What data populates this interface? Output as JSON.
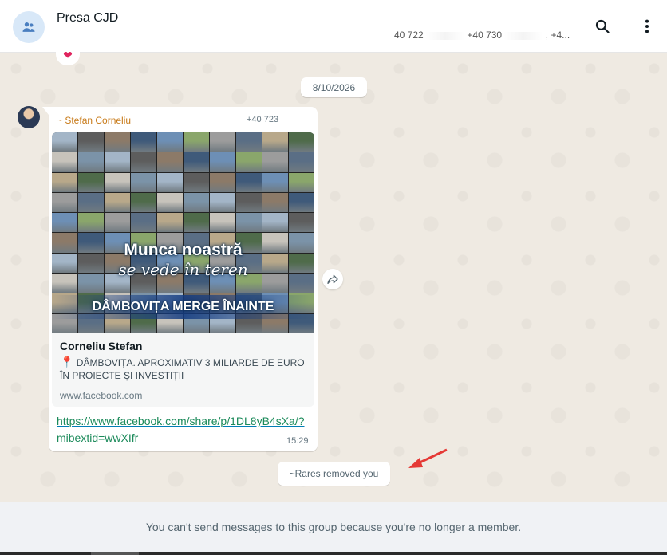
{
  "header": {
    "title": "Presa CJD",
    "participants_1": "40 722",
    "participants_2": "+40 730",
    "participants_3": ", +4..."
  },
  "date_chip": "8/10/2026",
  "message": {
    "sender_name": "~ Stefan Corneliu",
    "sender_phone": "+40 723",
    "preview": {
      "image_line1": "Munca noastră",
      "image_line2": "se vede în teren",
      "image_line3": "DÂMBOVIȚA MERGE ÎNAINTE",
      "title": "Corneliu Stefan",
      "description": "DÂMBOVIȚA. APROXIMATIV 3 MILIARDE DE EURO ÎN PROIECTE ȘI INVESTIȚII",
      "domain": "www.facebook.com"
    },
    "link": "https://www.facebook.com/share/p/1DL8yB4sXa/?mibextid=wwXIfr",
    "time": "15:29"
  },
  "system_message": "~Rareș removed you",
  "footer_text": "You can't send messages to this group because you're no longer a member.",
  "colors": {
    "sender_name": "#c87a18",
    "link": "#1b8a5a",
    "arrow": "#e53935"
  }
}
